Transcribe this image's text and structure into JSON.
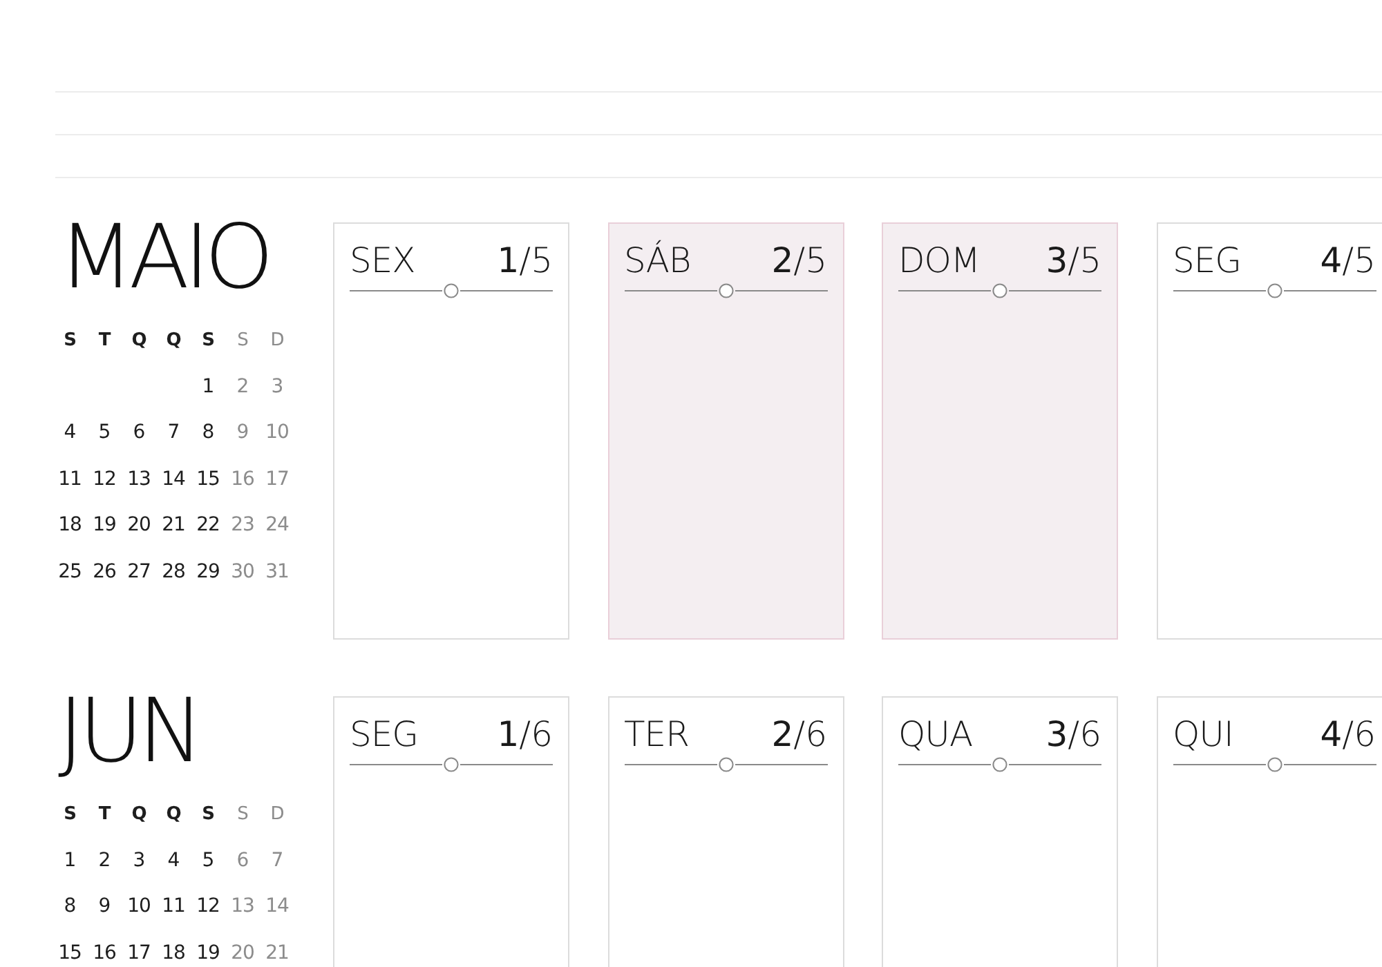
{
  "months": [
    {
      "name": "MAIO",
      "weekdays": [
        {
          "label": "S",
          "weekend": false
        },
        {
          "label": "T",
          "weekend": false
        },
        {
          "label": "Q",
          "weekend": false
        },
        {
          "label": "Q",
          "weekend": false
        },
        {
          "label": "S",
          "weekend": false
        },
        {
          "label": "S",
          "weekend": true
        },
        {
          "label": "D",
          "weekend": true
        }
      ],
      "weeks": [
        [
          {
            "day": "1"
          },
          {
            "day": "2"
          },
          {
            "day": "3"
          }
        ],
        [
          {
            "day": "4"
          },
          {
            "day": "5"
          },
          {
            "day": "6"
          },
          {
            "day": "7"
          },
          {
            "day": "8"
          },
          {
            "day": "9"
          },
          {
            "day": "10"
          }
        ],
        [
          {
            "day": "11"
          },
          {
            "day": "12"
          },
          {
            "day": "13"
          },
          {
            "day": "14"
          },
          {
            "day": "15"
          },
          {
            "day": "16"
          },
          {
            "day": "17"
          }
        ],
        [
          {
            "day": "18"
          },
          {
            "day": "19"
          },
          {
            "day": "20"
          },
          {
            "day": "21"
          },
          {
            "day": "22"
          },
          {
            "day": "23"
          },
          {
            "day": "24"
          }
        ],
        [
          {
            "day": "25"
          },
          {
            "day": "26"
          },
          {
            "day": "27"
          },
          {
            "day": "28"
          },
          {
            "day": "29"
          },
          {
            "day": "30"
          },
          {
            "day": "31"
          }
        ]
      ],
      "days": [
        {
          "weekday": "SEX",
          "date": "**1**/5",
          "weekend": false
        },
        {
          "weekday": "SÁB",
          "date": "**2**/5",
          "weekend": true
        },
        {
          "weekday": "DOM",
          "date": "**3**/5",
          "weekend": true
        },
        {
          "weekday": "SEG",
          "date": "**4**/5",
          "weekend": false
        }
      ]
    },
    {
      "name": "JUN",
      "weekdays": [
        {
          "label": "S",
          "weekend": false
        },
        {
          "label": "T",
          "weekend": false
        },
        {
          "label": "Q",
          "weekend": false
        },
        {
          "label": "Q",
          "weekend": false
        },
        {
          "label": "S",
          "weekend": false
        },
        {
          "label": "S",
          "weekend": true
        },
        {
          "label": "D",
          "weekend": true
        }
      ],
      "weeks": [
        [
          {
            "day": "1"
          },
          {
            "day": "2"
          },
          {
            "day": "3"
          },
          {
            "day": "4"
          },
          {
            "day": "5"
          },
          {
            "day": "6"
          },
          {
            "day": "7"
          }
        ],
        [
          {
            "day": "8"
          },
          {
            "day": "9"
          },
          {
            "day": "10"
          },
          {
            "day": "11"
          },
          {
            "day": "12"
          },
          {
            "day": "13"
          },
          {
            "day": "14"
          }
        ],
        [
          {
            "day": "15"
          },
          {
            "day": "16"
          },
          {
            "day": "17"
          },
          {
            "day": "18"
          },
          {
            "day": "19"
          },
          {
            "day": "20"
          },
          {
            "day": "21"
          }
        ]
      ],
      "days": [
        {
          "weekday": "SEG",
          "date": "**1**/6",
          "weekend": false
        },
        {
          "weekday": "TER",
          "date": "**2**/6",
          "weekend": false
        },
        {
          "weekday": "QUA",
          "date": "**3**/6",
          "weekend": false
        },
        {
          "weekday": "QUI",
          "date": "**4**/6",
          "weekend": false
        }
      ]
    }
  ]
}
